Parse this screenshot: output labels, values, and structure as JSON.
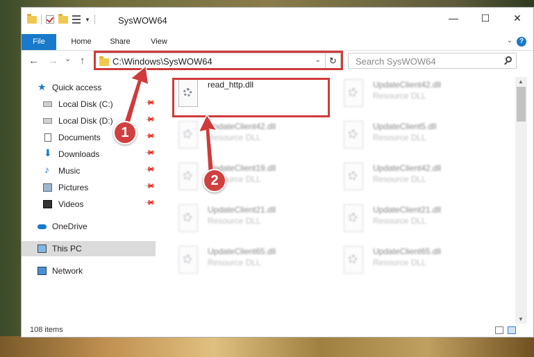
{
  "window": {
    "title": "SysWOW64",
    "minimize": "—",
    "maximize": "☐",
    "close": "✕"
  },
  "ribbon": {
    "tabs": [
      "File",
      "Home",
      "Share",
      "View"
    ],
    "help": "?"
  },
  "nav": {
    "back": "←",
    "forward": "→",
    "recent": "⌄",
    "up": "↑",
    "address": "C:\\Windows\\SysWOW64",
    "refresh": "↻",
    "search_placeholder": "Search SysWOW64"
  },
  "sidebar": {
    "items": [
      {
        "label": "Quick access",
        "icon": "star-icon",
        "pinned": false
      },
      {
        "label": "Local Disk (C:)",
        "icon": "disk-icon",
        "pinned": true
      },
      {
        "label": "Local Disk (D:)",
        "icon": "disk-icon",
        "pinned": true
      },
      {
        "label": "Documents",
        "icon": "documents-icon",
        "pinned": true
      },
      {
        "label": "Downloads",
        "icon": "download-icon",
        "pinned": true
      },
      {
        "label": "Music",
        "icon": "music-icon",
        "pinned": true
      },
      {
        "label": "Pictures",
        "icon": "pictures-icon",
        "pinned": true
      },
      {
        "label": "Videos",
        "icon": "videos-icon",
        "pinned": true
      },
      {
        "label": "OneDrive",
        "icon": "cloud-icon",
        "pinned": false
      },
      {
        "label": "This PC",
        "icon": "computer-icon",
        "pinned": false,
        "selected": true
      },
      {
        "label": "Network",
        "icon": "network-icon",
        "pinned": false
      }
    ]
  },
  "files": [
    {
      "name": "read_http.dll",
      "type": ""
    },
    {
      "name": "UpdateClient42.dll",
      "type": "Resource DLL"
    },
    {
      "name": "UpdateClient42.dll",
      "type": "Resource DLL"
    },
    {
      "name": "UpdateClient5.dll",
      "type": "Resource DLL"
    },
    {
      "name": "UpdateClient19.dll",
      "type": "Resource DLL"
    },
    {
      "name": "UpdateClient42.dll",
      "type": "Resource DLL"
    },
    {
      "name": "UpdateClient21.dll",
      "type": "Resource DLL"
    },
    {
      "name": "UpdateClient21.dll",
      "type": "Resource DLL"
    },
    {
      "name": "UpdateClient65.dll",
      "type": "Resource DLL"
    },
    {
      "name": "UpdateClient65.dll",
      "type": "Resource DLL"
    }
  ],
  "status": {
    "item_count": "108 items"
  },
  "annotations": {
    "step1": "1",
    "step2": "2",
    "color": "#d03a3a"
  }
}
